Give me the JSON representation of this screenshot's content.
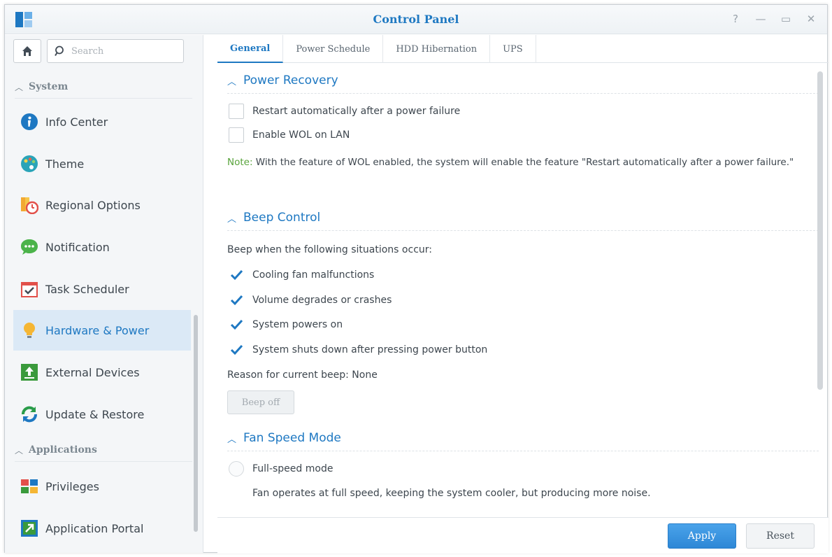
{
  "window": {
    "title": "Control Panel",
    "controls": [
      {
        "name": "help-icon",
        "glyph": "?"
      },
      {
        "name": "minimize-icon",
        "glyph": "—"
      },
      {
        "name": "maximize-icon",
        "glyph": "▭"
      },
      {
        "name": "close-icon",
        "glyph": "✕"
      }
    ]
  },
  "sidebar": {
    "search_placeholder": "Search",
    "sections": {
      "system": "System",
      "applications": "Applications"
    },
    "items": [
      {
        "label": "Info Center",
        "icon": "info-icon"
      },
      {
        "label": "Theme",
        "icon": "palette-icon"
      },
      {
        "label": "Regional Options",
        "icon": "regional-clock-icon"
      },
      {
        "label": "Notification",
        "icon": "chat-bubble-icon"
      },
      {
        "label": "Task Scheduler",
        "icon": "calendar-check-icon"
      },
      {
        "label": "Hardware & Power",
        "icon": "lightbulb-icon",
        "active": true
      },
      {
        "label": "External Devices",
        "icon": "upload-box-icon"
      },
      {
        "label": "Update & Restore",
        "icon": "refresh-icon"
      },
      {
        "label": "Privileges",
        "icon": "privileges-grid-icon"
      },
      {
        "label": "Application Portal",
        "icon": "portal-arrow-icon"
      }
    ]
  },
  "tabs": [
    {
      "label": "General",
      "active": true
    },
    {
      "label": "Power Schedule"
    },
    {
      "label": "HDD Hibernation"
    },
    {
      "label": "UPS"
    }
  ],
  "power_recovery": {
    "title": "Power Recovery",
    "options": [
      {
        "label": "Restart automatically after a power failure",
        "checked": false
      },
      {
        "label": "Enable WOL on LAN",
        "checked": false
      }
    ],
    "note_label": "Note:",
    "note_text": " With the feature of WOL enabled, the system will enable the feature \"Restart automatically after a power failure.\""
  },
  "beep_control": {
    "title": "Beep Control",
    "intro": "Beep when the following situations occur:",
    "options": [
      {
        "label": "Cooling fan malfunctions",
        "checked": true
      },
      {
        "label": "Volume degrades or crashes",
        "checked": true
      },
      {
        "label": "System powers on",
        "checked": true
      },
      {
        "label": "System shuts down after pressing power button",
        "checked": true
      }
    ],
    "reason": "Reason for current beep: None",
    "beep_off_label": "Beep off"
  },
  "fan_speed": {
    "title": "Fan Speed Mode",
    "option_label": "Full-speed mode",
    "option_desc": "Fan operates at full speed, keeping the system cooler, but producing more noise."
  },
  "footer": {
    "apply_label": "Apply",
    "reset_label": "Reset"
  },
  "colors": {
    "accent": "#1e78c2",
    "note_green": "#58a33b",
    "active_bg": "#dbe9f6"
  }
}
